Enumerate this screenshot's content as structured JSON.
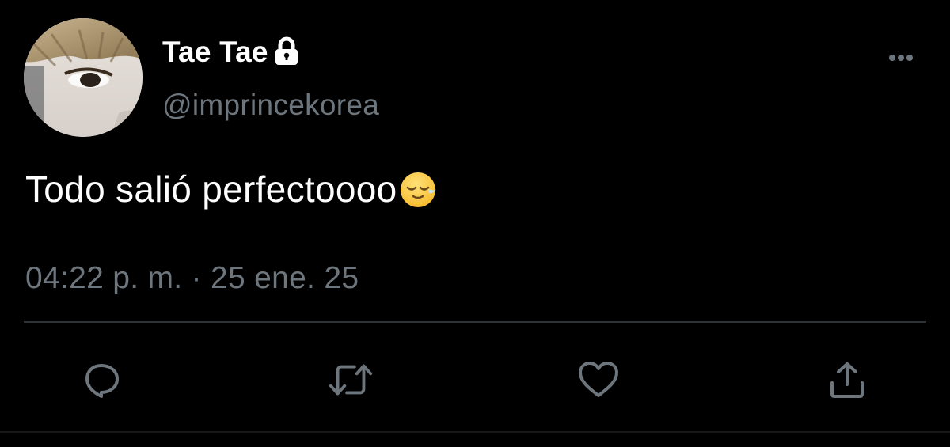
{
  "tweet": {
    "display_name": "Tae Tae",
    "handle": "@imprincekorea",
    "text": "Todo salió perfectoooo",
    "emoji": "sleepy-smiling-face",
    "timestamp": "04:22 p. m. · 25 ene. 25",
    "protected": true
  },
  "icons": {
    "lock": "lock-icon",
    "more": "more-options-icon",
    "reply": "reply-icon",
    "retweet": "retweet-icon",
    "like": "heart-icon",
    "share": "share-icon"
  },
  "colors": {
    "background": "#000000",
    "primary_text": "#ffffff",
    "secondary_text": "#6e767d",
    "divider": "#2f3336",
    "icon": "#6e767d"
  }
}
